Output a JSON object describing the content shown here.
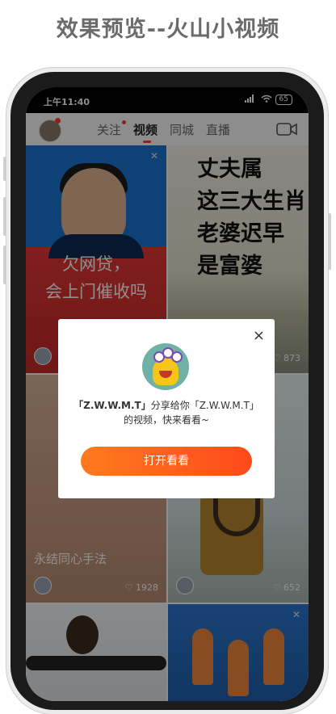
{
  "page_title": "效果预览--火山小视频",
  "status_bar": {
    "time": "上午11:40",
    "signal": "HD",
    "battery": "65"
  },
  "nav": {
    "tabs": [
      {
        "label": "关注",
        "has_dot": true
      },
      {
        "label": "视频",
        "active": true
      },
      {
        "label": "同城"
      },
      {
        "label": "直播"
      }
    ]
  },
  "feed": [
    {
      "caption_line1": "欠网贷，",
      "caption_line2": "会上门催收吗"
    },
    {
      "lines": [
        "丈夫属",
        "这三大生肖",
        "老婆迟早",
        "是富婆"
      ],
      "likes": "873"
    },
    {
      "title": "永结同心手法",
      "likes": "1928"
    },
    {
      "likes": "652"
    },
    {},
    {}
  ],
  "dialog": {
    "message_bold1": "「Z.W.W.M.T」",
    "message_mid": "分享给你",
    "message_bold2": "「Z.W.W.M.T」",
    "message_end": "的视频，快来看看~",
    "open_button": "打开看看",
    "close": "×"
  },
  "colors": {
    "accent": "#ff5a1f",
    "brand_red": "#ff3b30"
  }
}
